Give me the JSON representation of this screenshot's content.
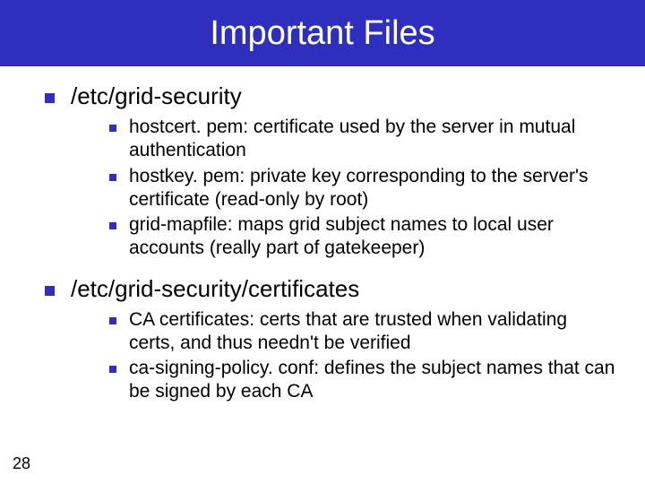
{
  "title": "Important Files",
  "sections": [
    {
      "heading": "/etc/grid-security",
      "items": [
        "hostcert. pem: certificate used by the server in mutual authentication",
        "hostkey. pem: private key corresponding to the server's certificate (read-only by root)",
        "grid-mapfile: maps grid subject names to local user accounts (really part of gatekeeper)"
      ]
    },
    {
      "heading": "/etc/grid-security/certificates",
      "items": [
        "CA certificates: certs that are trusted when validating certs, and thus needn't be verified",
        "ca-signing-policy. conf: defines the subject names that can be signed by each CA"
      ]
    }
  ],
  "page_number": "28"
}
